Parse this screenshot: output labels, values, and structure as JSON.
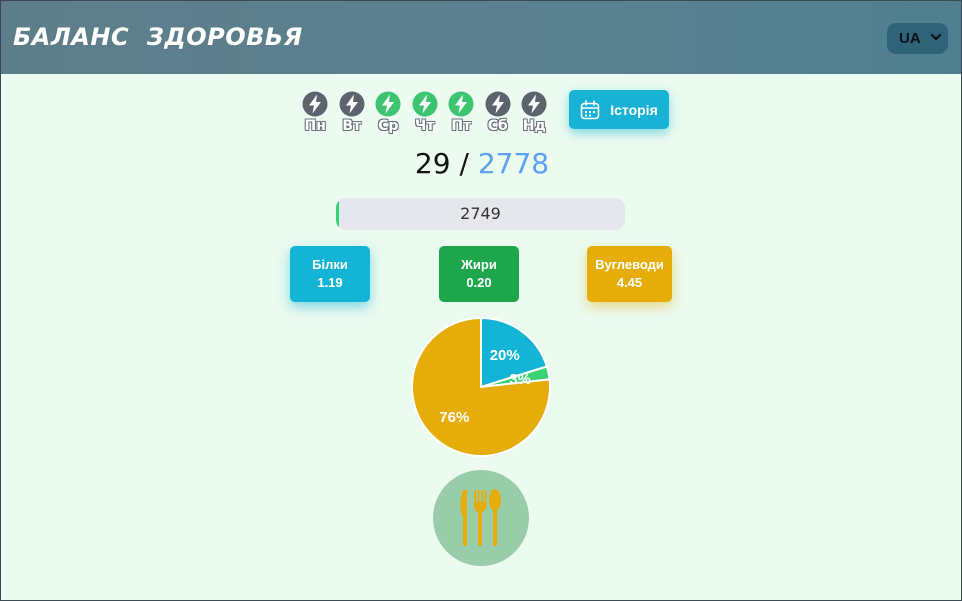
{
  "header": {
    "title": "БАЛАНС  ЗДОРОВЬЯ",
    "language": "UA",
    "language_icon": "chevron-down-icon"
  },
  "week": {
    "icon": "bolt-icon",
    "days": [
      {
        "label": "Пн",
        "active": false
      },
      {
        "label": "Вт",
        "active": false
      },
      {
        "label": "Ср",
        "active": true
      },
      {
        "label": "Чт",
        "active": true
      },
      {
        "label": "Пт",
        "active": true
      },
      {
        "label": "Сб",
        "active": false
      },
      {
        "label": "Нд",
        "active": false
      }
    ],
    "colors": {
      "active": "#3cc46e",
      "inactive": "#5b646d"
    }
  },
  "history_button": {
    "label": "Історія",
    "icon": "calendar-icon"
  },
  "calories": {
    "consumed": "29",
    "separator": "/",
    "goal": "2778"
  },
  "progress": {
    "remaining": "2749",
    "fill_fraction": 0.01
  },
  "macros": {
    "protein": {
      "label": "Білки",
      "value": "1.19",
      "color": "#14b4d6"
    },
    "fat": {
      "label": "Жири",
      "value": "0.20",
      "color": "#1ea64d"
    },
    "carbs": {
      "label": "Вуглеводи",
      "value": "4.45",
      "color": "#e5ac0a"
    }
  },
  "chart_data": {
    "type": "pie",
    "categories": [
      "Білки",
      "Жири",
      "Вуглеводи"
    ],
    "values": [
      20,
      3,
      76
    ],
    "labels": [
      "20%",
      "3%",
      "76%"
    ],
    "colors": [
      "#14b4d6",
      "#3ad374",
      "#e5ac0a"
    ]
  },
  "plate_icon": "cutlery-icon"
}
